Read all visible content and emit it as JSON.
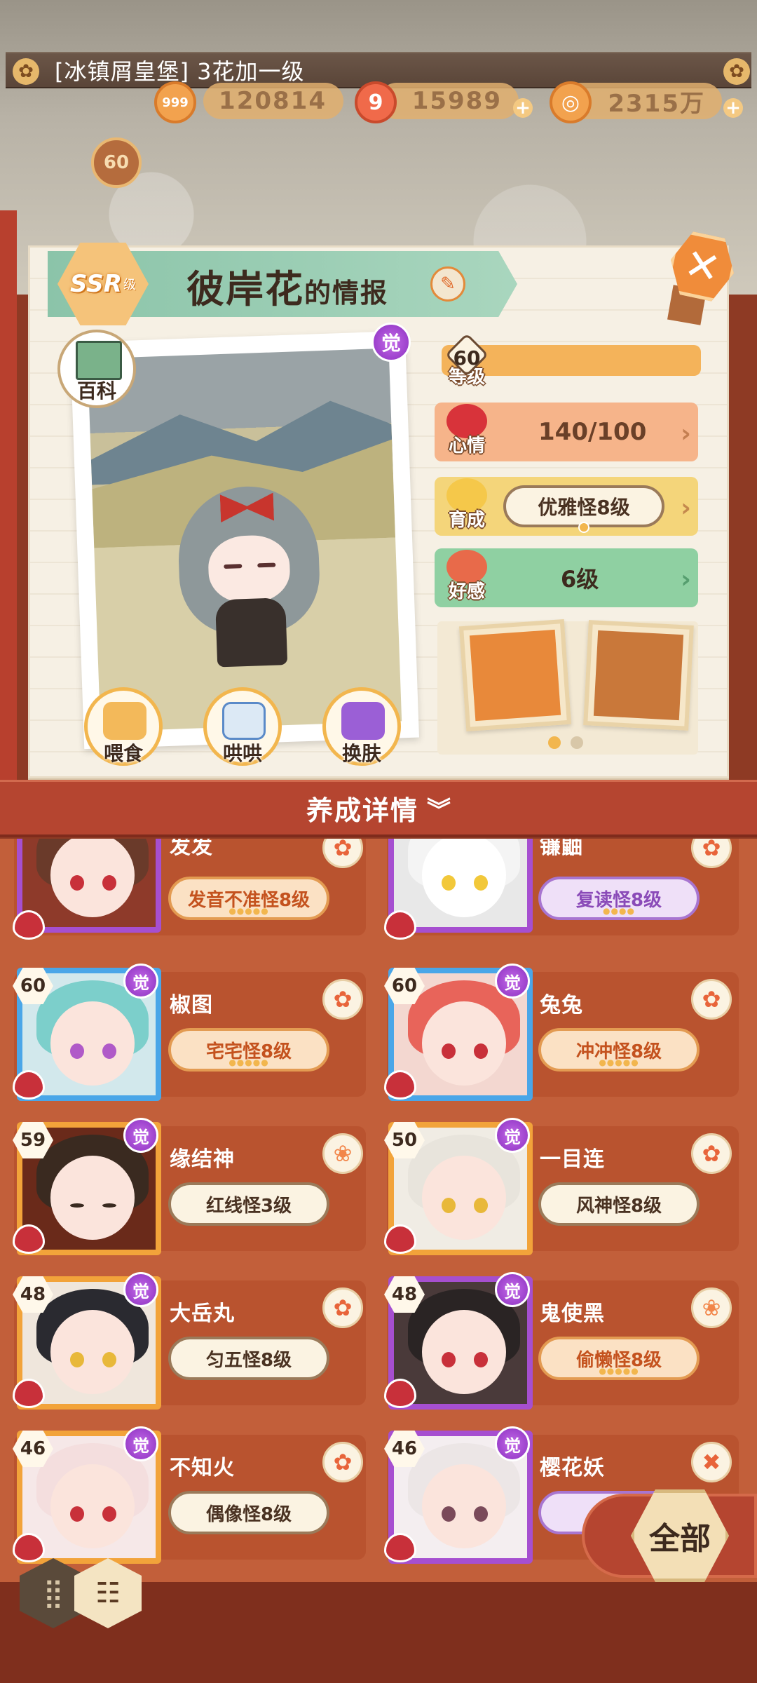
{
  "banner": {
    "text": "[冰镇屑皇堡] 3花加一级"
  },
  "resources": {
    "r1": "120814",
    "r2": "15989",
    "r3": "2315万",
    "r1_icon_text": "999"
  },
  "player_level": "60",
  "info": {
    "rarity": "SSR",
    "rarity_suffix": "级",
    "name": "彼岸花",
    "name_suffix": "的情报",
    "awaken": "觉",
    "baike": "百科",
    "level_value": "60",
    "level_label": "等级",
    "mood_label": "心情",
    "mood_value": "140/100",
    "grow_label": "育成",
    "grow_value": "优雅怪8级",
    "affinity_label": "好感",
    "affinity_value": "6级",
    "actions": [
      "喂食",
      "哄哄",
      "换肤"
    ]
  },
  "detail_bar": {
    "label": "养成详情",
    "chevron": "»"
  },
  "characters": [
    {
      "name": "发发",
      "level": "",
      "title": "发音不准怪8级",
      "stars": "●●●●●",
      "frame": "#a64fd0",
      "pill": "orange"
    },
    {
      "name": "镰鼬",
      "level": "",
      "title": "复读怪8级",
      "stars": "●●●●",
      "frame": "#a64fd0",
      "pill": "purple"
    },
    {
      "name": "椒图",
      "level": "60",
      "title": "宅宅怪8级",
      "stars": "●●●●●",
      "frame": "#4aa6e8",
      "pill": "orange"
    },
    {
      "name": "兔兔",
      "level": "60",
      "title": "冲冲怪8级",
      "stars": "●●●●●",
      "frame": "#4aa6e8",
      "pill": "orange"
    },
    {
      "name": "缘结神",
      "level": "59",
      "title": "红线怪3级",
      "stars": "",
      "frame": "#f2a33a",
      "pill": "plain"
    },
    {
      "name": "一目连",
      "level": "50",
      "title": "风神怪8级",
      "stars": "",
      "frame": "#f2a33a",
      "pill": "plain"
    },
    {
      "name": "大岳丸",
      "level": "48",
      "title": "匀五怪8级",
      "stars": "",
      "frame": "#f2a33a",
      "pill": "plain"
    },
    {
      "name": "鬼使黑",
      "level": "48",
      "title": "偷懒怪8级",
      "stars": "●●●●●",
      "frame": "#a64fd0",
      "pill": "orange"
    },
    {
      "name": "不知火",
      "level": "46",
      "title": "偶像怪8级",
      "stars": "",
      "frame": "#f2a33a",
      "pill": "plain"
    },
    {
      "name": "樱花妖",
      "level": "46",
      "title": "樱",
      "stars": "",
      "frame": "#a64fd0",
      "pill": "purple"
    }
  ],
  "all_button": "全部",
  "colors": {
    "accent": "#b54530",
    "awaken": "#8b2fc0",
    "mood": "#f6b48a",
    "growth": "#f4d57a",
    "affinity": "#8fd0a2"
  }
}
